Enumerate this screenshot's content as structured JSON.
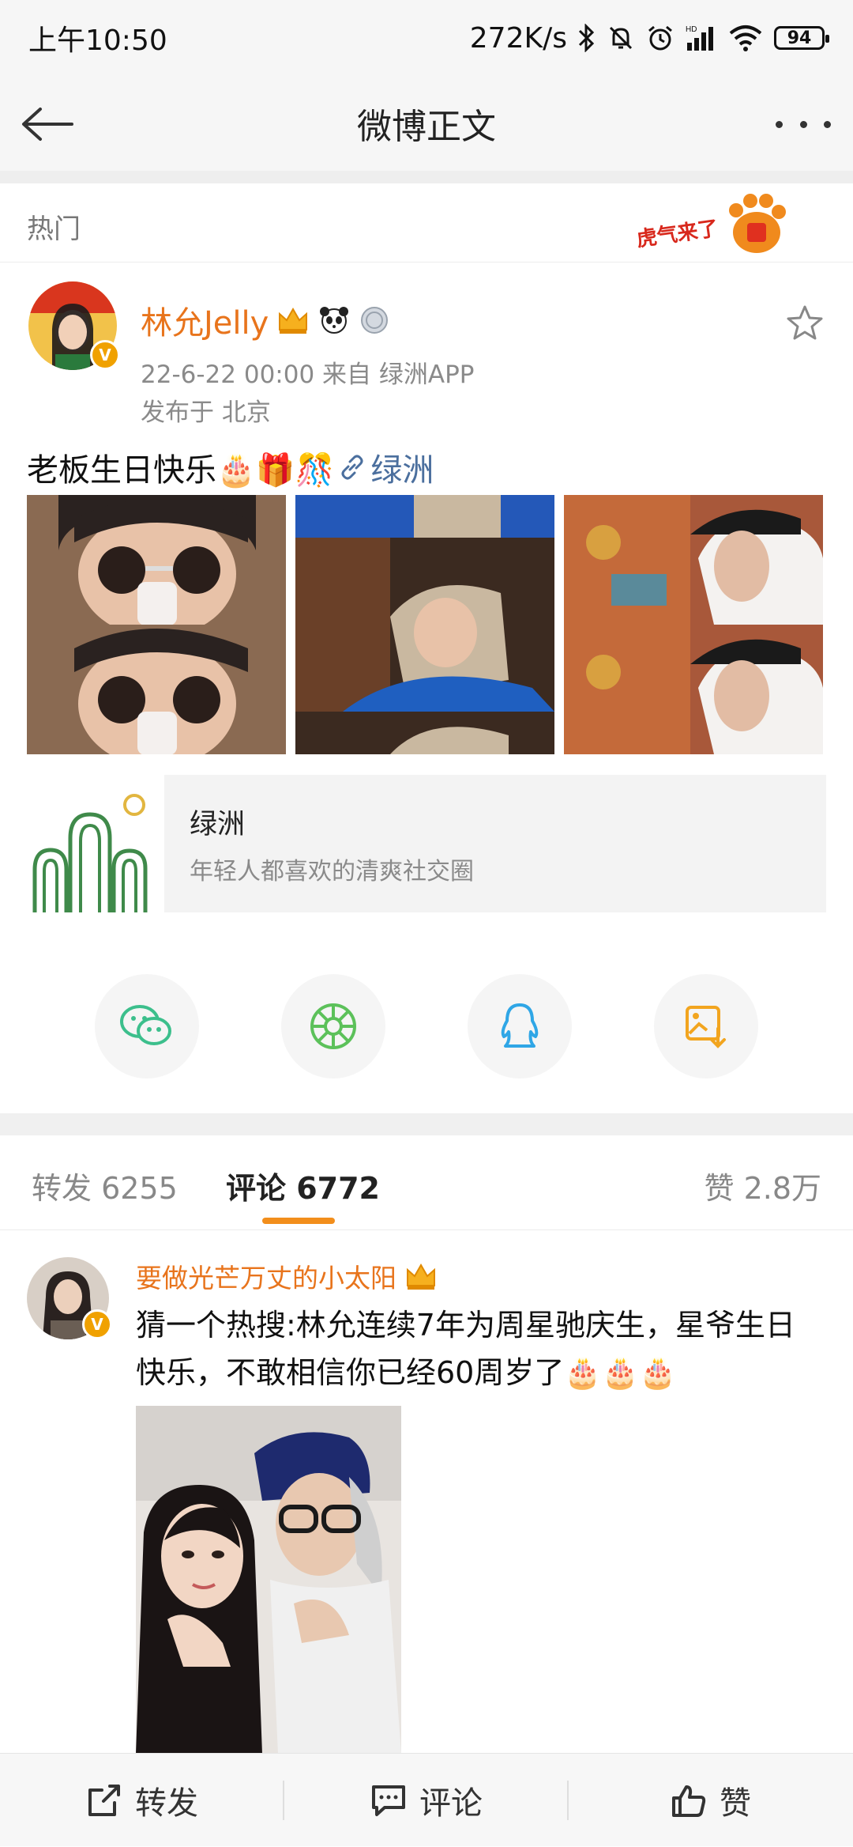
{
  "status_bar": {
    "time": "上午10:50",
    "net_speed": "272K/s",
    "battery": "94"
  },
  "header": {
    "title": "微博正文"
  },
  "hot": {
    "label": "热门",
    "banner_text": "虎气来了"
  },
  "post": {
    "author": "林允Jelly",
    "meta": "22-6-22 00:00   来自 绿洲APP",
    "location": "发布于 北京",
    "text": "老板生日快乐🎂🎁🎊",
    "link_label": "绿洲",
    "card": {
      "name": "绿洲",
      "desc": "年轻人都喜欢的清爽社交圈"
    }
  },
  "share": {
    "icons": [
      "wechat-icon",
      "moments-icon",
      "qq-icon",
      "save-image-icon"
    ]
  },
  "tabs": {
    "repost": "转发 6255",
    "comment": "评论 6772",
    "like": "赞 2.8万"
  },
  "comment": {
    "user": "要做光芒万丈的小太阳",
    "text": "猜一个热搜:林允连续7年为周星驰庆生，星爷生日快乐，不敢相信你已经60周岁了🎂🎂🎂"
  },
  "bottom_bar": {
    "repost": "转发",
    "comment": "评论",
    "like": "赞"
  },
  "colors": {
    "accent_orange": "#e8741c",
    "link_blue": "#4b6f9e",
    "tab_underline": "#f28e1c"
  }
}
